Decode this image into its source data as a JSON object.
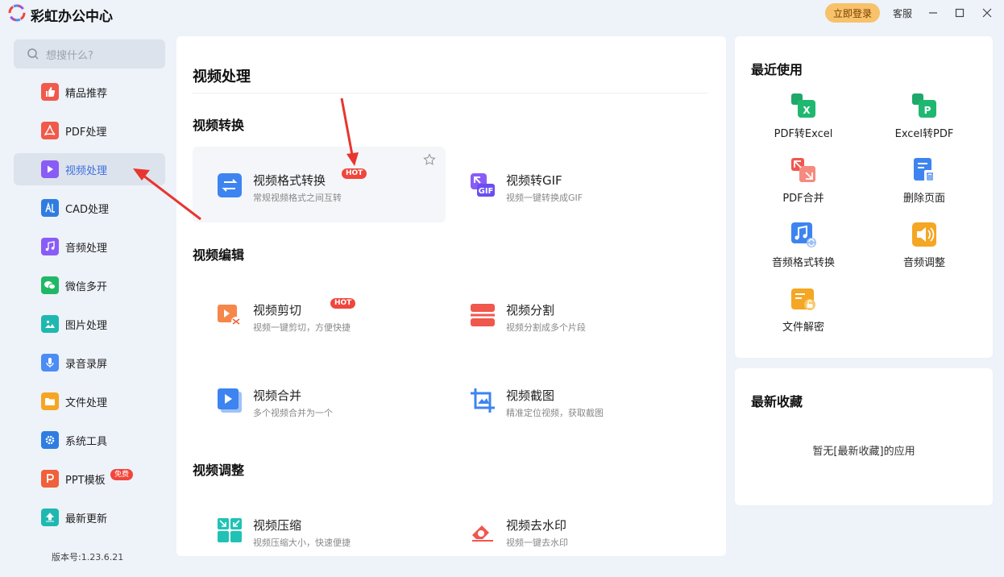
{
  "app": {
    "title": "彩虹办公中心",
    "login_label": "立即登录",
    "service_label": "客服"
  },
  "sidebar": {
    "search_placeholder": "想搜什么?",
    "items": [
      {
        "label": "精品推荐",
        "icon": "thumbs-up-icon",
        "color": "#f05a4a"
      },
      {
        "label": "PDF处理",
        "icon": "pdf-icon",
        "color": "#f05a4a"
      },
      {
        "label": "视频处理",
        "icon": "play-icon",
        "color": "#8a5cf6",
        "active": true
      },
      {
        "label": "CAD处理",
        "icon": "cad-icon",
        "color": "#2f7de1"
      },
      {
        "label": "音频处理",
        "icon": "music-icon",
        "color": "#8a5cf6"
      },
      {
        "label": "微信多开",
        "icon": "wechat-icon",
        "color": "#20b865"
      },
      {
        "label": "图片处理",
        "icon": "image-icon",
        "color": "#1fb8b0"
      },
      {
        "label": "录音录屏",
        "icon": "mic-icon",
        "color": "#4b8cf5"
      },
      {
        "label": "文件处理",
        "icon": "folder-icon",
        "color": "#f5a623"
      },
      {
        "label": "系统工具",
        "icon": "gear-icon",
        "color": "#2f7de1"
      },
      {
        "label": "PPT模板",
        "icon": "ppt-icon",
        "color": "#f0603a",
        "badge": "免费"
      },
      {
        "label": "最新更新",
        "icon": "upload-icon",
        "color": "#1fb8b0"
      }
    ],
    "version": "版本号:1.23.6.21"
  },
  "main": {
    "title": "视频处理",
    "sections": [
      {
        "title": "视频转换"
      },
      {
        "title": "视频编辑"
      },
      {
        "title": "视频调整"
      }
    ],
    "cards": [
      {
        "title": "视频格式转换",
        "desc": "常规视频格式之间互转",
        "hot": "HOT",
        "icon": "convert-icon"
      },
      {
        "title": "视频转GIF",
        "desc": "视频一键转换成GIF",
        "icon": "gif-icon"
      },
      {
        "title": "视频剪切",
        "desc": "视频一键剪切，方便快捷",
        "hot": "HOT",
        "icon": "scissors-icon"
      },
      {
        "title": "视频分割",
        "desc": "视频分割成多个片段",
        "icon": "split-icon"
      },
      {
        "title": "视频合并",
        "desc": "多个视频合并为一个",
        "icon": "merge-icon"
      },
      {
        "title": "视频截图",
        "desc": "精准定位视频，获取截图",
        "icon": "crop-icon"
      },
      {
        "title": "视频压缩",
        "desc": "视频压缩大小，快速便捷",
        "icon": "compress-icon"
      },
      {
        "title": "视频去水印",
        "desc": "视频一键去水印",
        "icon": "eraser-icon"
      }
    ]
  },
  "recent": {
    "title": "最近使用",
    "items": [
      {
        "label": "PDF转Excel",
        "icon": "pdf-to-excel-icon"
      },
      {
        "label": "Excel转PDF",
        "icon": "excel-to-pdf-icon"
      },
      {
        "label": "PDF合并",
        "icon": "pdf-merge-icon"
      },
      {
        "label": "删除页面",
        "icon": "delete-page-icon"
      },
      {
        "label": "音频格式转换",
        "icon": "audio-convert-icon"
      },
      {
        "label": "音频调整",
        "icon": "audio-adjust-icon"
      },
      {
        "label": "文件解密",
        "icon": "file-decrypt-icon"
      }
    ]
  },
  "favorites": {
    "title": "最新收藏",
    "empty_text": "暂无[最新收藏]的应用"
  }
}
